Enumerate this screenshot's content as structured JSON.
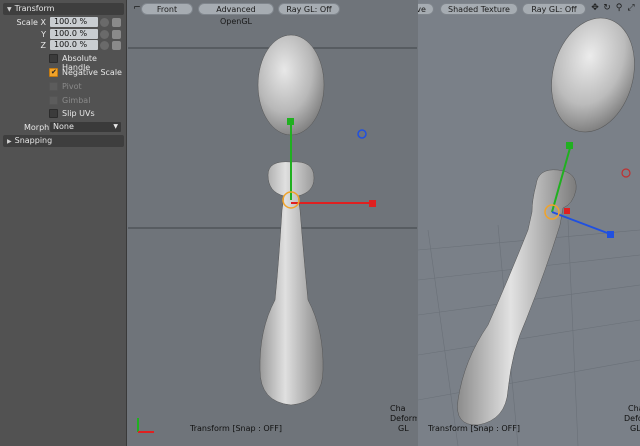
{
  "panel": {
    "transform_title": "Transform",
    "scale_x_label": "Scale X",
    "scale_x_value": "100.0 %",
    "y_label": "Y",
    "y_value": "100.0 %",
    "z_label": "Z",
    "z_value": "100.0 %",
    "absolute_handle": "Absolute Handle",
    "negative_scale": "Negative Scale",
    "pivot": "Pivot",
    "gimbal": "Gimbal",
    "slip_uvs": "Slip UVs",
    "morph_label": "Morph",
    "morph_value": "None",
    "snapping_title": "Snapping"
  },
  "viewport_left": {
    "view_label": "Front",
    "render_label": "Advanced OpenGL",
    "raygl_label": "Ray GL: Off",
    "status": "Transform  [Snap : OFF]",
    "corner_lines": [
      "Cha",
      "Deform",
      "GL"
    ]
  },
  "viewport_right": {
    "view_label": "ive",
    "shading_label": "Shaded Texture",
    "raygl_label": "Ray GL: Off",
    "status": "Transform  [Snap : OFF]",
    "corner_lines": [
      "Cha",
      "Deform",
      "GL"
    ]
  },
  "colors": {
    "panel_bg": "#525252",
    "accent_orange": "#f0a32a",
    "axis_x": "#e02020",
    "axis_y": "#20b020",
    "axis_z": "#2050e0"
  }
}
